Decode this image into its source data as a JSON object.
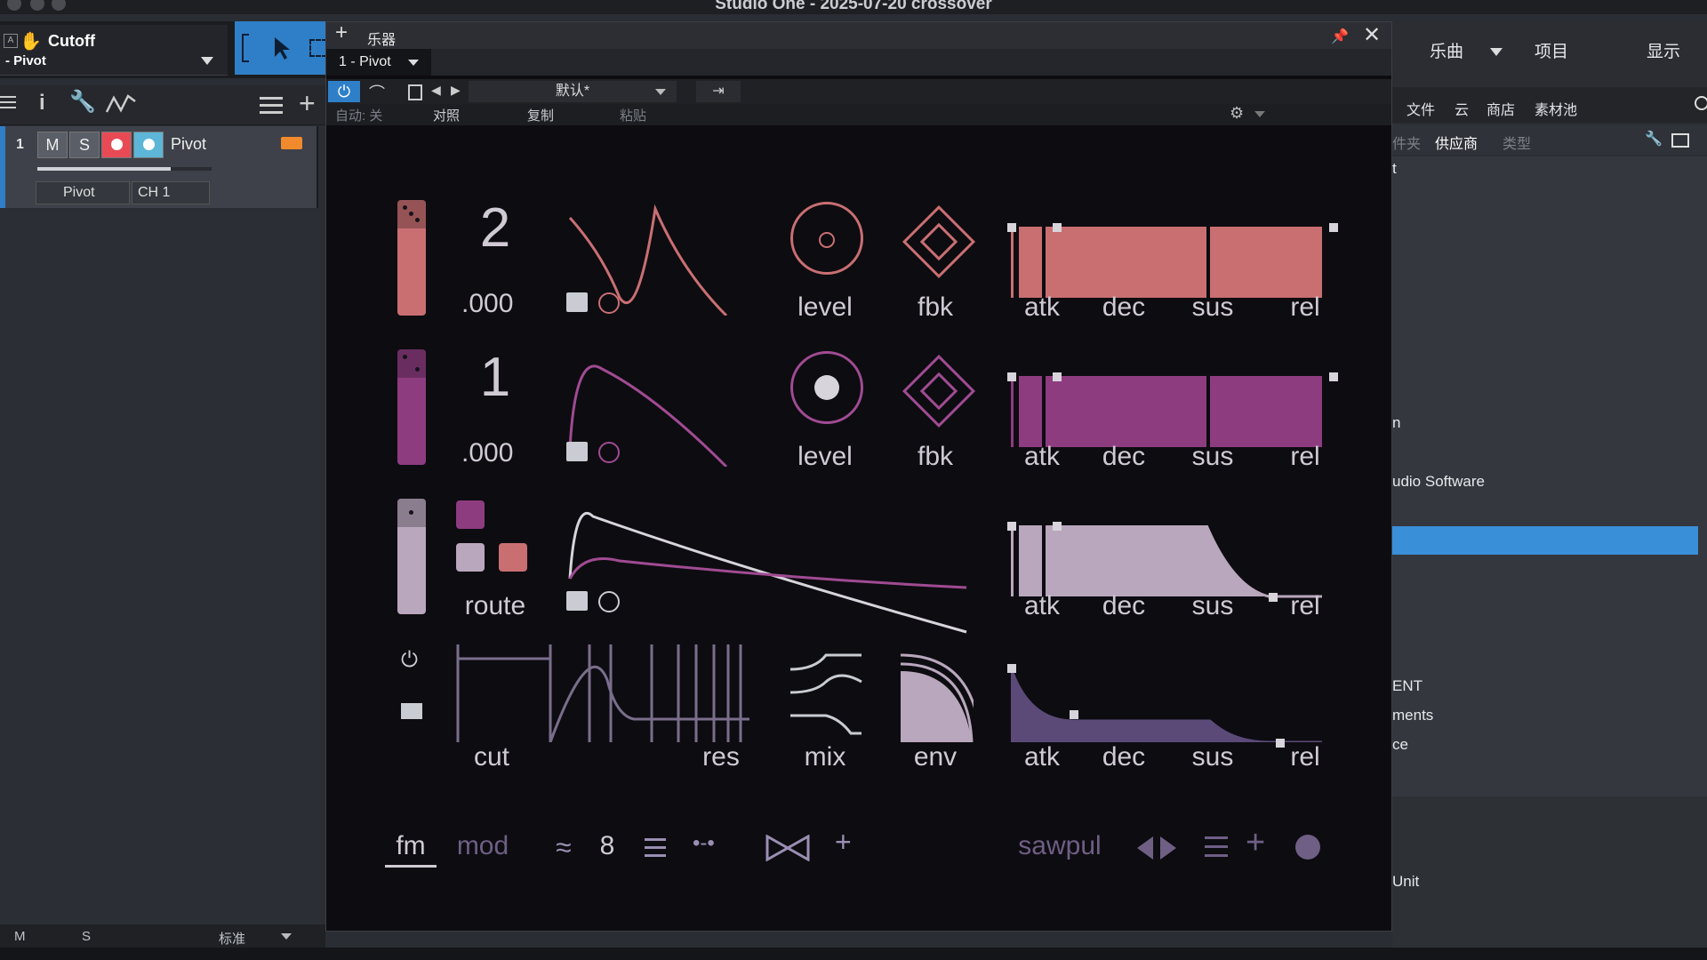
{
  "window_title": "Studio One - 2025-07-20 crossover",
  "left": {
    "param_name": "Cutoff",
    "param_device": "- Pivot",
    "track": {
      "number": "1",
      "mute": "M",
      "solo": "S",
      "name": "Pivot",
      "instrument": "Pivot",
      "channel": "CH 1"
    },
    "bottom": {
      "m": "M",
      "s": "S",
      "mode": "标准"
    }
  },
  "right": {
    "menu": [
      "乐曲",
      "项目",
      "显示"
    ],
    "tabs": [
      "文件",
      "云",
      "商店",
      "素材池"
    ],
    "subtabs": [
      "件夹",
      "供应商",
      "类型"
    ],
    "list": [
      "t",
      "n",
      "udio Software",
      "ENT",
      "ments",
      "ce",
      "Unit"
    ]
  },
  "plugin": {
    "title": "乐器",
    "instance": "1 - Pivot",
    "preset": "默认*",
    "auto": "自动: 关",
    "compare": "对照",
    "copy": "复制",
    "paste": "粘贴",
    "rows": [
      {
        "num": "2",
        "dec": ".000",
        "l1": "level",
        "l2": "fbk",
        "env": [
          "atk",
          "dec",
          "sus",
          "rel"
        ]
      },
      {
        "num": "1",
        "dec": ".000",
        "l1": "level",
        "l2": "fbk",
        "env": [
          "atk",
          "dec",
          "sus",
          "rel"
        ]
      },
      {
        "route": "route",
        "env": [
          "atk",
          "dec",
          "sus",
          "rel"
        ]
      },
      {
        "cut": "cut",
        "res": "res",
        "mix": "mix",
        "envl": "env",
        "env": [
          "atk",
          "dec",
          "sus",
          "rel"
        ]
      }
    ],
    "bottom": {
      "fm": "fm",
      "mod": "mod",
      "voices": "8",
      "wave": "sawpul"
    }
  },
  "colors": {
    "op1": "#c96f72",
    "op2": "#8e3c80",
    "op3": "#b9a7bd",
    "filter": "#5b4a78",
    "accent": "#2f7fc8"
  }
}
